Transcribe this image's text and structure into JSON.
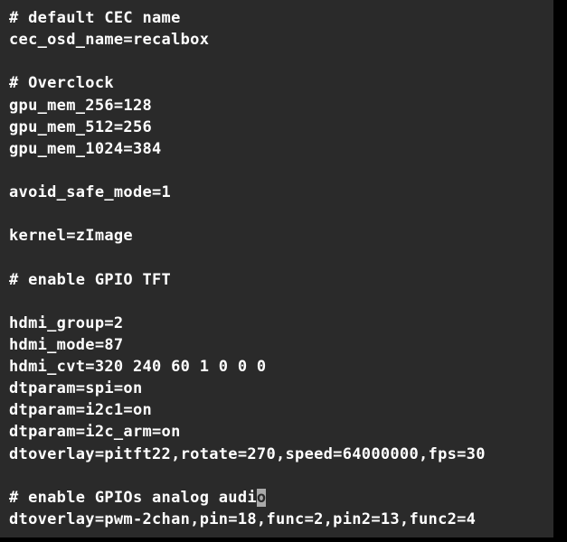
{
  "terminal": {
    "lines": [
      "# default CEC name",
      "cec_osd_name=recalbox",
      "",
      "# Overclock",
      "gpu_mem_256=128",
      "gpu_mem_512=256",
      "gpu_mem_1024=384",
      "",
      "avoid_safe_mode=1",
      "",
      "kernel=zImage",
      "",
      "# enable GPIO TFT",
      "",
      "hdmi_group=2",
      "hdmi_mode=87",
      "hdmi_cvt=320 240 60 1 0 0 0",
      "dtparam=spi=on",
      "dtparam=i2c1=on",
      "dtparam=i2c_arm=on",
      "dtoverlay=pitft22,rotate=270,speed=64000000,fps=30",
      "",
      "# enable GPIOs analog audi",
      "dtoverlay=pwm-2chan,pin=18,func=2,pin2=13,func2=4"
    ],
    "cursor": {
      "line": 22,
      "pre": "# enable GPIOs analog audi",
      "char": "o"
    }
  }
}
